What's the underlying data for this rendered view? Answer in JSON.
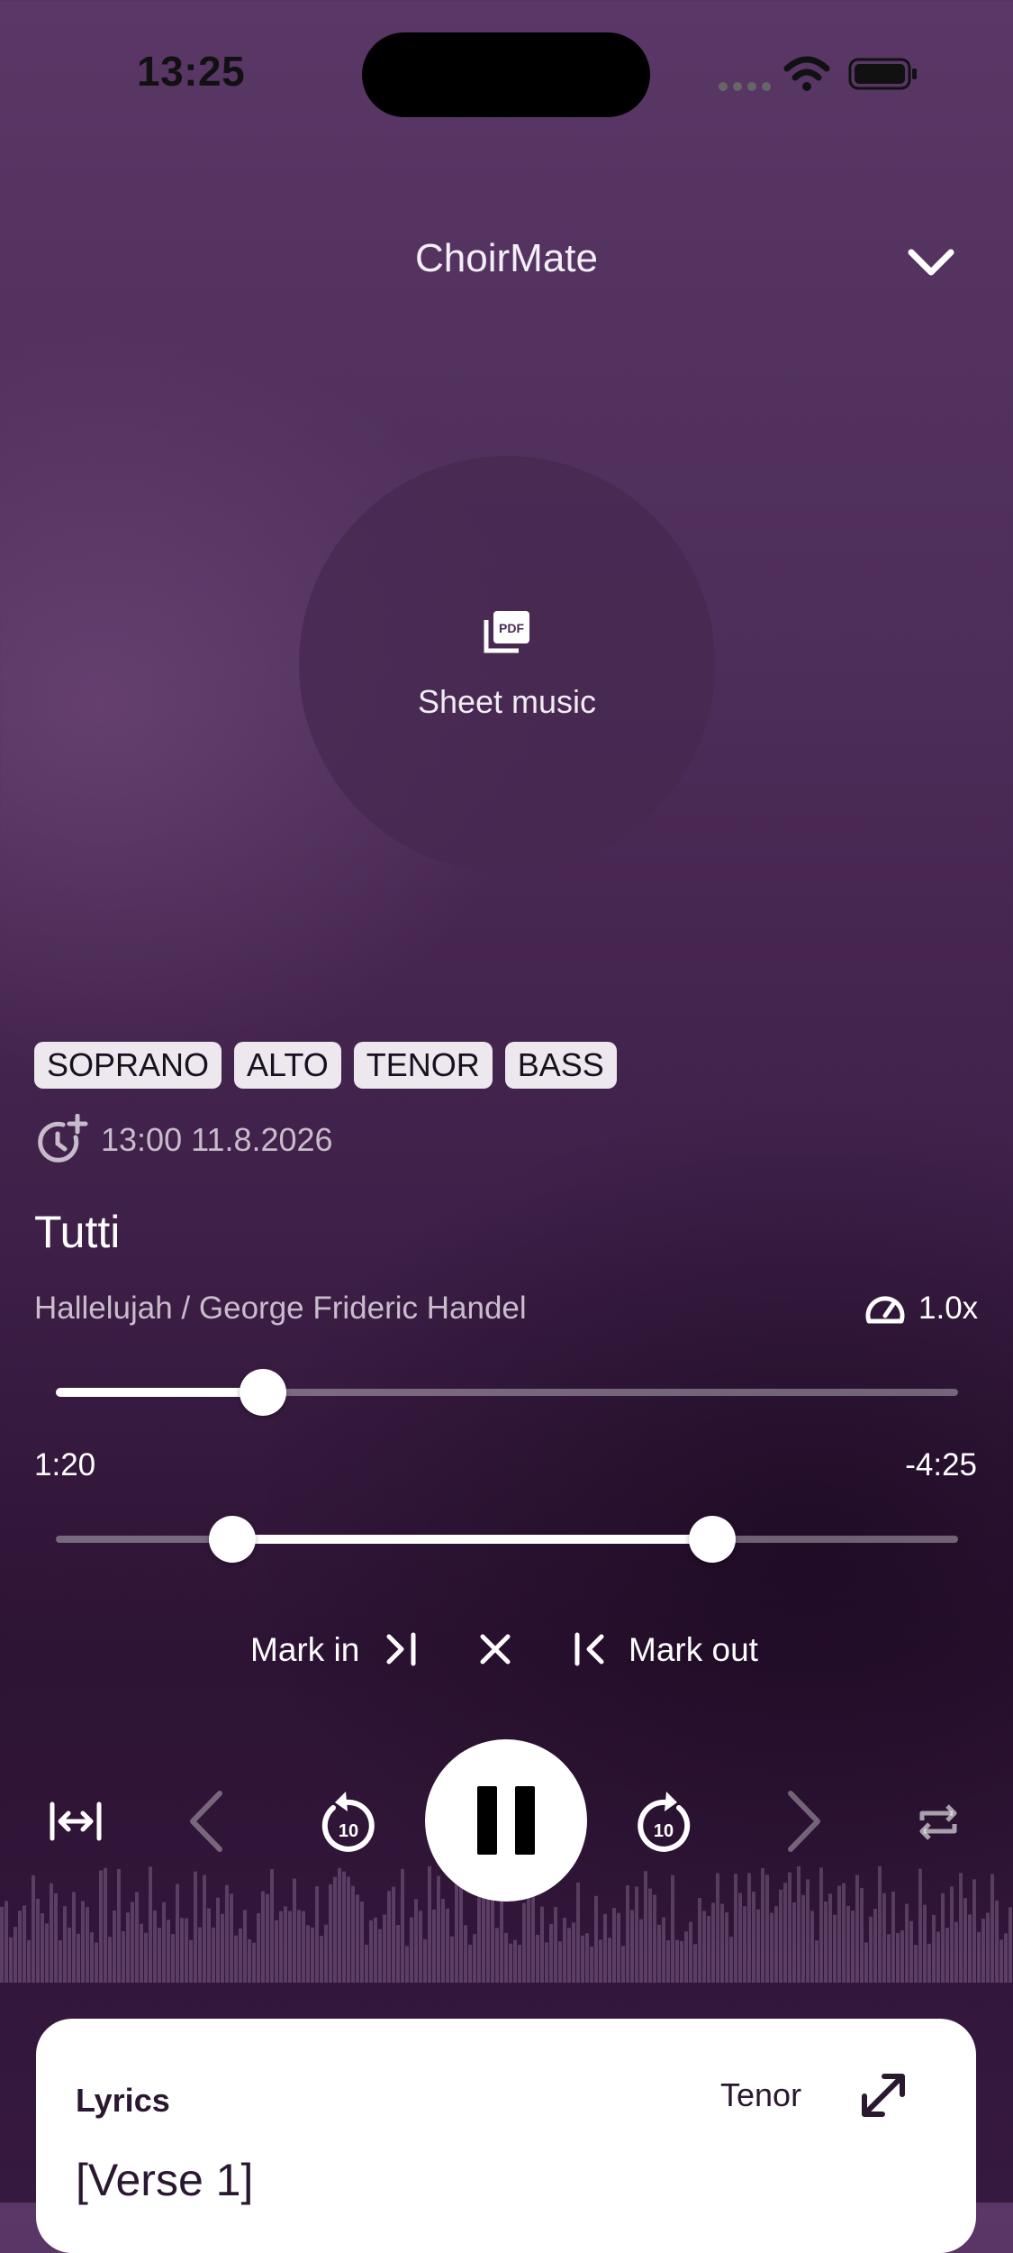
{
  "status_bar": {
    "time": "13:25"
  },
  "header": {
    "title": "ChoirMate"
  },
  "sheet_music": {
    "label": "Sheet music"
  },
  "voices": [
    "SOPRANO",
    "ALTO",
    "TENOR",
    "BASS"
  ],
  "schedule": {
    "datetime": "13:00 11.8.2026"
  },
  "track": {
    "title": "Tutti",
    "subtitle": "Hallelujah / George Frideric Handel",
    "speed": "1.0x",
    "elapsed": "1:20",
    "remaining": "-4:25",
    "progress_fraction": 0.23,
    "loop_start_fraction": 0.196,
    "loop_end_fraction": 0.728
  },
  "marks": {
    "mark_in_label": "Mark in",
    "mark_out_label": "Mark out"
  },
  "lyrics": {
    "title": "Lyrics",
    "voice": "Tenor",
    "first_line": "[Verse 1]"
  },
  "colors": {
    "accent": "#ffffff",
    "background_top": "#5a3766",
    "background_bottom": "#2d1334",
    "chip_bg": "#ece8ee"
  }
}
